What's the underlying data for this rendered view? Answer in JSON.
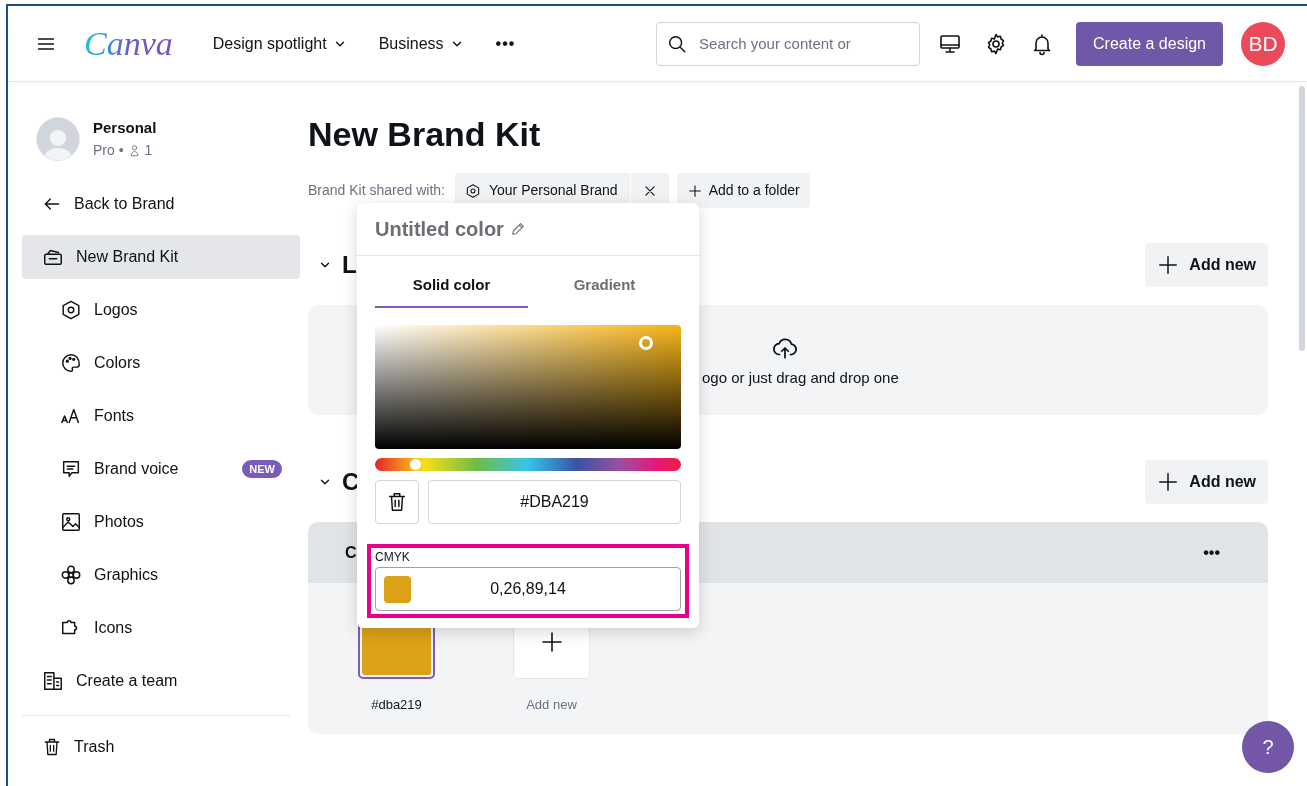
{
  "header": {
    "logo": "Canva",
    "nav": [
      {
        "label": "Design spotlight",
        "dropdown": true
      },
      {
        "label": "Business",
        "dropdown": true
      }
    ],
    "more": "•••",
    "search": {
      "placeholder": "Search your content or"
    },
    "create_button": "Create a design",
    "avatar": "BD"
  },
  "sidebar": {
    "profile": {
      "name": "Personal",
      "plan": "Pro •",
      "members": "1"
    },
    "back": "Back to Brand",
    "items": [
      {
        "label": "New Brand Kit",
        "kind": "kit",
        "selected": true,
        "children": [
          {
            "label": "Logos",
            "kind": "logo",
            "selected": false
          },
          {
            "label": "Colors",
            "kind": "palette",
            "selected": false
          },
          {
            "label": "Fonts",
            "kind": "fonts",
            "selected": false
          },
          {
            "label": "Brand voice",
            "kind": "voice",
            "selected": false,
            "badge": "NEW"
          },
          {
            "label": "Photos",
            "kind": "photo",
            "selected": false
          },
          {
            "label": "Graphics",
            "kind": "graphic",
            "selected": false
          },
          {
            "label": "Icons",
            "kind": "puzzle",
            "selected": false
          }
        ]
      },
      {
        "label": "Create a team",
        "kind": "team",
        "selected": false
      }
    ],
    "trash": "Trash"
  },
  "main": {
    "title": "New Brand Kit",
    "shared_label": "Brand Kit shared with:",
    "shared_chip": "Your Personal Brand",
    "add_folder": "Add to a folder",
    "sections": [
      {
        "heading": "L",
        "expanded": true,
        "add_button": "Add new",
        "kind": "upload",
        "upload_text": "ogo or just drag and drop one"
      },
      {
        "heading": "C",
        "expanded": true,
        "add_button": "Add new",
        "kind": "palette",
        "palette_name": "C",
        "more": "•••",
        "colors": [
          {
            "label": "#dba219",
            "color": "#dba219",
            "selected": true
          }
        ],
        "add_tile": "Add new"
      }
    ]
  },
  "popover": {
    "name": "Untitled color",
    "tabs": [
      {
        "label": "Solid color",
        "selected": true
      },
      {
        "label": "Gradient",
        "selected": false
      }
    ],
    "hue": {
      "level": 0.13
    },
    "hex": "#DBA219",
    "cmyk_label": "CMYK",
    "cmyk": "0,26,89,14",
    "highlighted": true
  },
  "help": "?"
}
